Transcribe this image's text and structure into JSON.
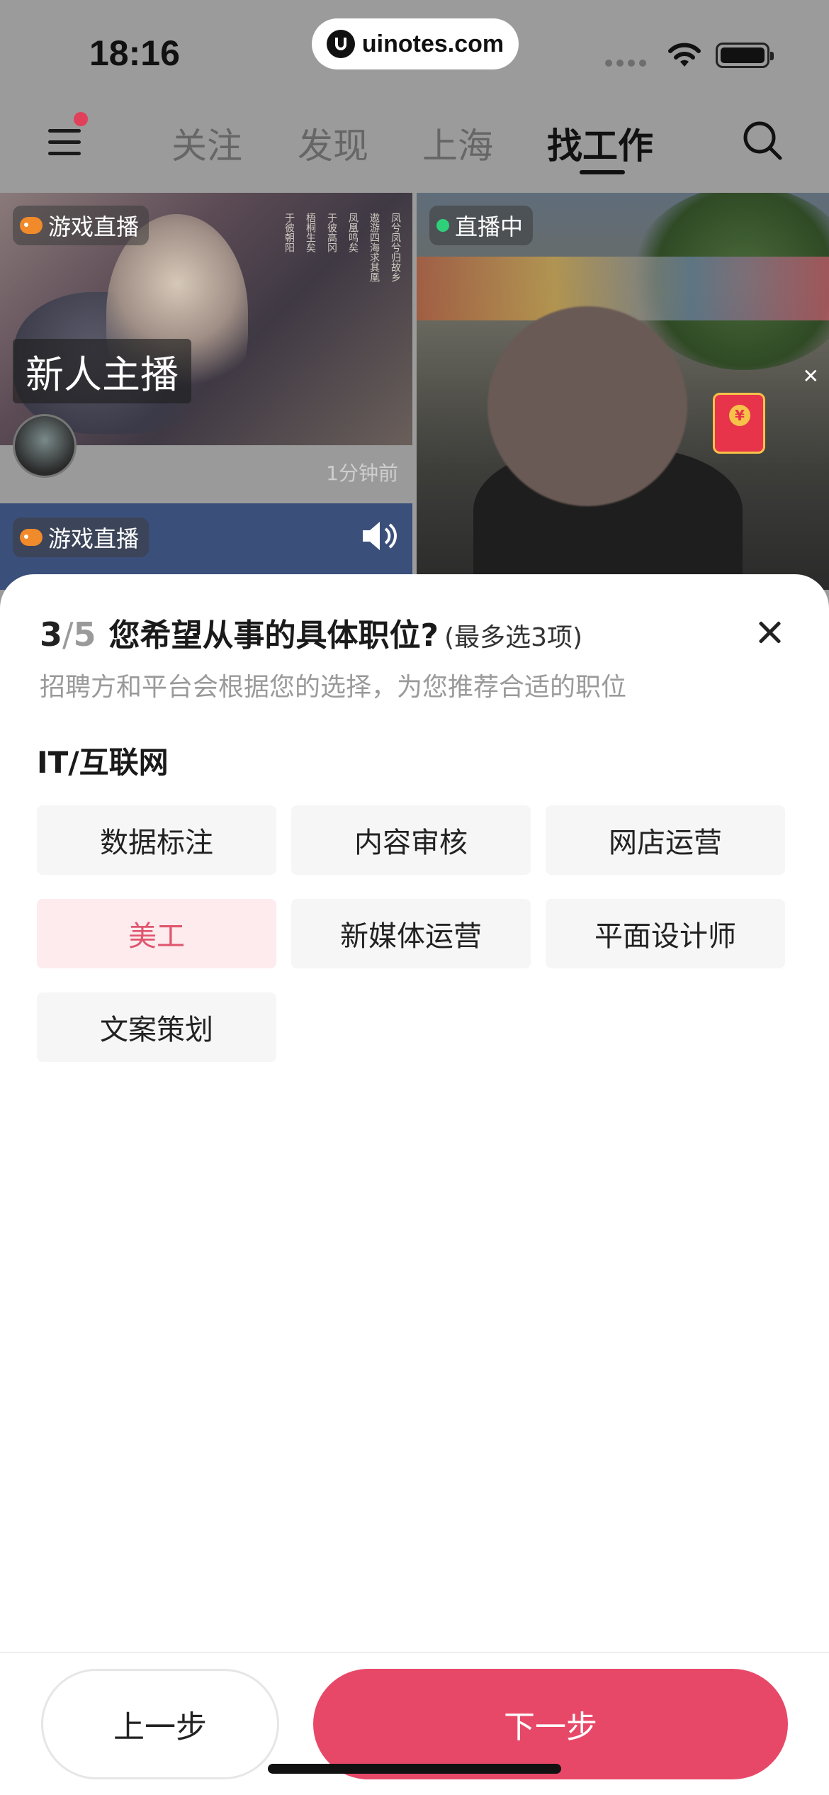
{
  "status_bar": {
    "time": "18:16",
    "site": "uinotes.com"
  },
  "top_nav": {
    "tabs": [
      {
        "label": "关注"
      },
      {
        "label": "发现"
      },
      {
        "label": "上海"
      },
      {
        "label": "找工作",
        "active": true
      }
    ]
  },
  "feed": {
    "left_card": {
      "tag": "游戏直播",
      "banner": "新人主播",
      "time_ago": "1分钟前",
      "poem_lines": [
        "凤兮凤兮归故乡",
        "遨游四海求其凰",
        "凤凰鸣矣",
        "于彼高冈",
        "梧桐生矣",
        "于彼朝阳"
      ]
    },
    "left_card_2": {
      "tag": "游戏直播"
    },
    "right_card": {
      "tag": "直播中"
    }
  },
  "sheet": {
    "step_current": "3",
    "step_separator": "/",
    "step_total": "5",
    "question": "您希望从事的具体职位?",
    "hint": "(最多选3项)",
    "subtitle": "招聘方和平台会根据您的选择，为您推荐合适的职位",
    "category": "IT/互联网",
    "options": [
      {
        "label": "数据标注",
        "selected": false
      },
      {
        "label": "内容审核",
        "selected": false
      },
      {
        "label": "网店运营",
        "selected": false
      },
      {
        "label": "美工",
        "selected": true
      },
      {
        "label": "新媒体运营",
        "selected": false
      },
      {
        "label": "平面设计师",
        "selected": false
      },
      {
        "label": "文案策划",
        "selected": false
      }
    ]
  },
  "footer": {
    "prev_label": "上一步",
    "next_label": "下一步"
  },
  "colors": {
    "accent": "#e84868",
    "selected_bg": "#fdebee",
    "selected_text": "#e0566e"
  }
}
